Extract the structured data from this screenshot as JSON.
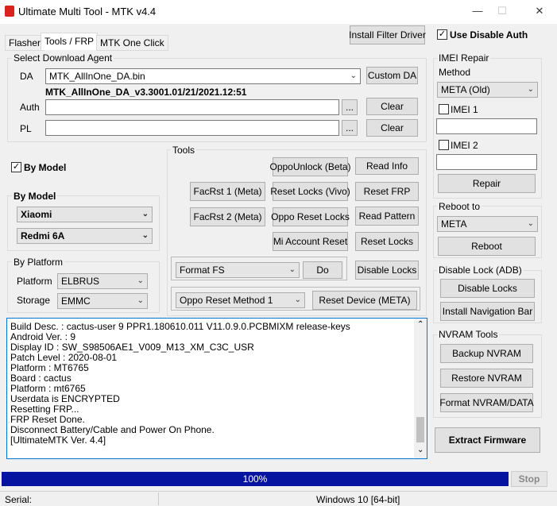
{
  "window": {
    "title": "Ultimate Multi Tool - MTK v4.4",
    "min": "—",
    "max": "☐",
    "close": "✕"
  },
  "tabs": [
    {
      "label": "Flasher"
    },
    {
      "label": "Tools / FRP"
    },
    {
      "label": "MTK One Click"
    }
  ],
  "header": {
    "install_filter_driver": "Install Filter Driver",
    "use_disable_auth": "Use Disable Auth"
  },
  "download_agent": {
    "title": "Select Download Agent",
    "da_label": "DA",
    "da_value": "MTK_AllInOne_DA.bin",
    "custom_da": "Custom DA",
    "da_info": "MTK_AllInOne_DA_v3.3001.01/21/2021.12:51",
    "auth_label": "Auth",
    "pl_label": "PL",
    "browse": "...",
    "clear": "Clear"
  },
  "by_model_check": "By Model",
  "by_model": {
    "title": "By Model",
    "brand": "Xiaomi",
    "model": "Redmi 6A"
  },
  "by_platform": {
    "title": "By Platform",
    "platform_label": "Platform",
    "platform_value": "ELBRUS",
    "storage_label": "Storage",
    "storage_value": "EMMC"
  },
  "tools": {
    "title": "Tools",
    "oppo_unlock": "OppoUnlock (Beta)",
    "read_info": "Read Info",
    "facrst1": "FacRst 1 (Meta)",
    "reset_locks_vivo": "Reset Locks (Vivo)",
    "reset_frp": "Reset FRP",
    "facrst2": "FacRst 2 (Meta)",
    "oppo_reset_locks": "Oppo Reset Locks",
    "read_pattern": "Read Pattern",
    "mi_account_reset": "Mi Account Reset",
    "reset_locks": "Reset Locks",
    "format_value": "Format FS",
    "do": "Do",
    "disable_locks": "Disable Locks",
    "oppo_method": "Oppo Reset Method 1",
    "reset_device_meta": "Reset Device (META)"
  },
  "imei_repair": {
    "title": "IMEI Repair",
    "method_label": "Method",
    "method_value": "META (Old)",
    "imei1": "IMEI 1",
    "imei2": "IMEI 2",
    "repair": "Repair"
  },
  "reboot": {
    "title": "Reboot to",
    "value": "META",
    "button": "Reboot"
  },
  "disable_lock_adb": {
    "title": "Disable Lock (ADB)",
    "disable_locks": "Disable Locks",
    "install_nav_bar": "Install Navigation Bar"
  },
  "nvram": {
    "title": "NVRAM Tools",
    "backup": "Backup NVRAM",
    "restore": "Restore NVRAM",
    "format": "Format NVRAM/DATA"
  },
  "extract_firmware": "Extract Firmware",
  "log": [
    "Build Desc. : cactus-user 9 PPR1.180610.011 V11.0.9.0.PCBMIXM release-keys",
    "Android Ver. : 9",
    "Display ID : SW_S98506AE1_V009_M13_XM_C3C_USR",
    "Patch Level : 2020-08-01",
    "Platform : MT6765",
    "Board : cactus",
    "Platform : mt6765",
    "Userdata is ENCRYPTED",
    "Resetting FRP...",
    "FRP Reset Done.",
    "Disconnect Battery/Cable and Power On Phone.",
    "[UltimateMTK Ver. 4.4]"
  ],
  "progress": {
    "value": 1.0,
    "text": "100%"
  },
  "stop": "Stop",
  "status": {
    "serial_label": "Serial:",
    "os": "Windows 10 [64-bit]"
  }
}
